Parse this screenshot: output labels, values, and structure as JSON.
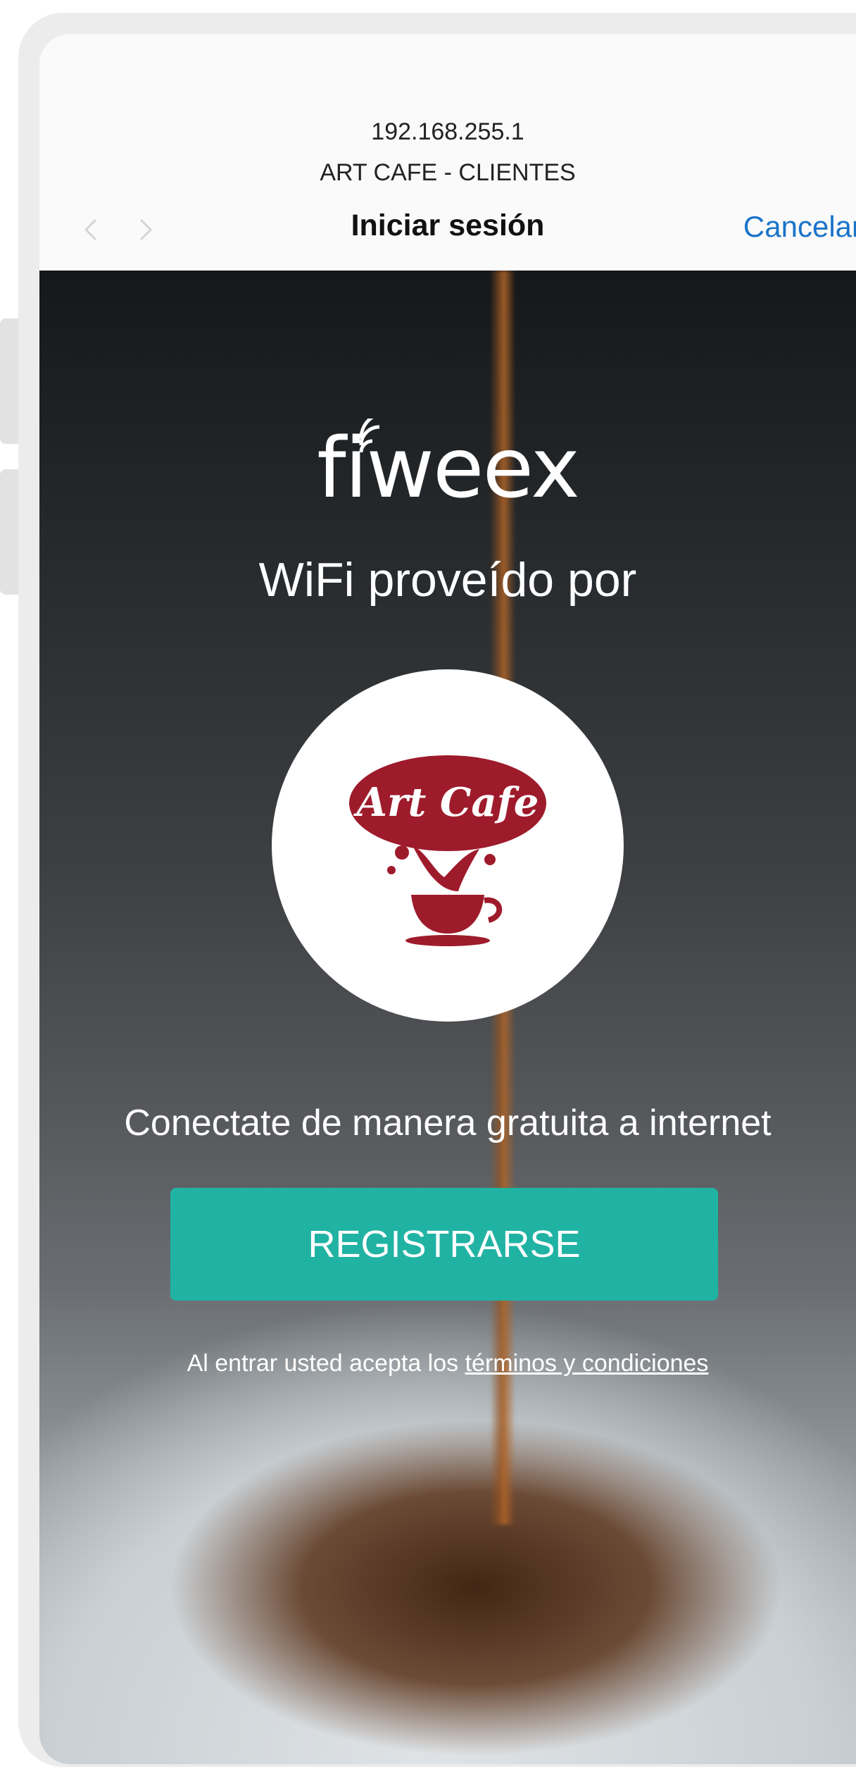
{
  "header": {
    "url": "192.168.255.1",
    "network_name": "ART CAFE - CLIENTES",
    "title": "Iniciar sesión",
    "cancel_label": "Cancelar",
    "back_icon": "chevron-left-icon",
    "forward_icon": "chevron-right-icon",
    "accent_color": "#1a73c9"
  },
  "portal": {
    "provider_logo": "fiweex",
    "provided_by": "WiFi proveído por",
    "brand_logo_text": "Art Cafe",
    "tagline": "Conectate de manera gratuita a internet",
    "register_label": "REGISTRARSE",
    "register_color": "#20b3a4",
    "terms_prefix": "Al entrar usted acepta los",
    "terms_link": "términos y condiciones"
  }
}
